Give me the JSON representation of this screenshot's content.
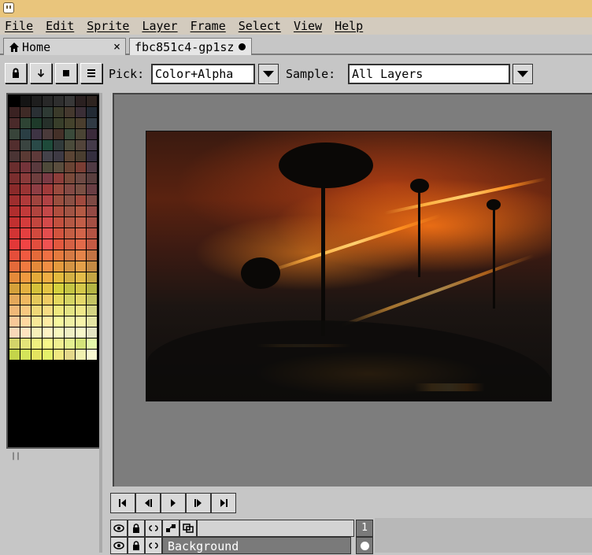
{
  "menu": [
    "File",
    "Edit",
    "Sprite",
    "Layer",
    "Frame",
    "Select",
    "View",
    "Help"
  ],
  "tabs": {
    "home": "Home",
    "home_close": "×",
    "sprite": "fbc851c4-gp1sz"
  },
  "toolbar": {
    "pick_label": "Pick:",
    "pick_value": "Color+Alpha",
    "sample_label": "Sample:",
    "sample_value": "All Layers"
  },
  "palette": [
    "#000000",
    "#141414",
    "#1e1e1e",
    "#282828",
    "#2e2e2e",
    "#383838",
    "#2a2020",
    "#2e2420",
    "#3a2222",
    "#3e2a26",
    "#2a3034",
    "#2e3a34",
    "#3a3a2a",
    "#44382e",
    "#3a2e36",
    "#222a34",
    "#4a2a2a",
    "#2e4434",
    "#1e3a2a",
    "#26302a",
    "#383e2a",
    "#44422c",
    "#4a3e2e",
    "#303a44",
    "#38443a",
    "#2a3e44",
    "#3e3444",
    "#4a3a3a",
    "#443028",
    "#3a4a3a",
    "#4a4434",
    "#3a2a3a",
    "#522e2e",
    "#3a4440",
    "#2a4a48",
    "#1e4a3a",
    "#303a3a",
    "#4a4a3a",
    "#52443a",
    "#443a4a",
    "#4a3434",
    "#5a3a34",
    "#5e3a3a",
    "#44424a",
    "#3e3a44",
    "#5a4434",
    "#4a3e30",
    "#342e3e",
    "#6a2e2e",
    "#74343a",
    "#5a3a3e",
    "#4e4a3a",
    "#5a4e3e",
    "#6a4434",
    "#7a3e34",
    "#503a44",
    "#7a2e2e",
    "#8a3a3a",
    "#6e3e3e",
    "#7a3a44",
    "#8e3e3a",
    "#7a4a3a",
    "#6e4a44",
    "#5a3e3e",
    "#8a2a2a",
    "#9a3434",
    "#8e3e44",
    "#a03a3a",
    "#9a4a3e",
    "#844a44",
    "#7a5044",
    "#6a3e44",
    "#9e2e2e",
    "#b03a3a",
    "#a0443e",
    "#b04244",
    "#9a4e3e",
    "#8a5044",
    "#a04a3e",
    "#7e4a44",
    "#b02e2e",
    "#c23a3a",
    "#b0443e",
    "#c44848",
    "#b04e3e",
    "#a05444",
    "#b45a44",
    "#944a44",
    "#c23030",
    "#d43c3c",
    "#c2463e",
    "#d44a4a",
    "#c2503e",
    "#b45844",
    "#c25e48",
    "#a45044",
    "#d23434",
    "#e44040",
    "#d24a3e",
    "#e44e4e",
    "#d2543e",
    "#c45e44",
    "#d2644a",
    "#b45444",
    "#e23838",
    "#f04444",
    "#e24e3e",
    "#f05252",
    "#e2583e",
    "#d46044",
    "#e26a4a",
    "#c45a44",
    "#e44e3a",
    "#f05a40",
    "#e46a3a",
    "#f07044",
    "#e47a3e",
    "#d47a44",
    "#e4844a",
    "#c47444",
    "#e46a3a",
    "#f07a40",
    "#e48a3a",
    "#f08e44",
    "#e49a3e",
    "#d49444",
    "#e4a04a",
    "#c48a44",
    "#e48a3a",
    "#f09a40",
    "#e4aa3a",
    "#f0ae44",
    "#e4ba3e",
    "#d4b044",
    "#e4bc4a",
    "#c4a444",
    "#d4a03a",
    "#e4b040",
    "#d4c03a",
    "#e4c444",
    "#d4d03e",
    "#c4c444",
    "#d4c84a",
    "#b4b444",
    "#e4a85a",
    "#f0b860",
    "#e4c85a",
    "#f0cc64",
    "#e4d85e",
    "#d4d464",
    "#e4d86a",
    "#c4c464",
    "#f0b878",
    "#f8c880",
    "#f0d878",
    "#f8dc84",
    "#f0e87e",
    "#e4e484",
    "#f0e88a",
    "#d4d484",
    "#f8c898",
    "#ffd8a0",
    "#f8e898",
    "#ffeca4",
    "#f8f89e",
    "#f0f0a4",
    "#f8f4aa",
    "#e4e4a4",
    "#f8d8b8",
    "#ffe4c0",
    "#f8f0b8",
    "#fff4c4",
    "#f8f8be",
    "#f0f0c4",
    "#f8f8ca",
    "#e4e4c4",
    "#d4d46a",
    "#e4e47a",
    "#f0f080",
    "#f8f88a",
    "#f0f090",
    "#e4f090",
    "#d4e47a",
    "#e4f8aa",
    "#c4d44a",
    "#d4e45a",
    "#e4e460",
    "#e4f06a",
    "#f0e880",
    "#e4d88a",
    "#f0f0b0",
    "#f8f8d0"
  ]
}
